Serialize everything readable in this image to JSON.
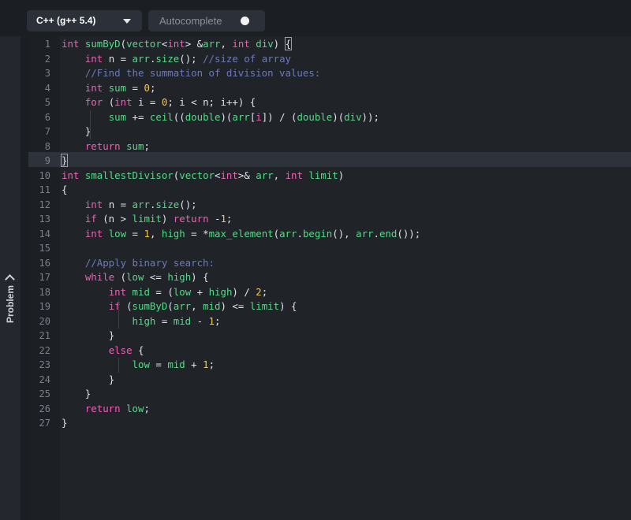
{
  "toolbar": {
    "language": "C++ (g++ 5.4)",
    "autocomplete_label": "Autocomplete"
  },
  "sidebar": {
    "label": "Problem"
  },
  "colors": {
    "keyword": "#f25fb4",
    "type": "#58c1f6",
    "function": "#56db87",
    "number": "#f2c55c",
    "comment": "#6f79b8",
    "text": "#dfe3ea",
    "variable": "#c5d36b"
  },
  "editor": {
    "current_line": 9,
    "lines": [
      {
        "n": "1",
        "t": [
          [
            "k",
            "int"
          ],
          [
            "p",
            " "
          ],
          [
            "f",
            "sumByD"
          ],
          [
            "p",
            "("
          ],
          [
            "f",
            "vector"
          ],
          [
            "p",
            "<"
          ],
          [
            "k",
            "int"
          ],
          [
            "p",
            "> &"
          ],
          [
            "f",
            "arr"
          ],
          [
            "p",
            ", "
          ],
          [
            "k",
            "int"
          ],
          [
            "p",
            " "
          ],
          [
            "f",
            "div"
          ],
          [
            "p",
            ") "
          ],
          [
            "bm",
            "{"
          ]
        ]
      },
      {
        "n": "2",
        "t": [
          [
            "i",
            "    "
          ],
          [
            "k",
            "int"
          ],
          [
            "p",
            " n = "
          ],
          [
            "f",
            "arr"
          ],
          [
            "p",
            "."
          ],
          [
            "f",
            "size"
          ],
          [
            "p",
            "(); "
          ],
          [
            "c",
            "//size of array"
          ]
        ]
      },
      {
        "n": "3",
        "t": [
          [
            "i",
            "    "
          ],
          [
            "c",
            "//Find the summation of division values:"
          ]
        ]
      },
      {
        "n": "4",
        "t": [
          [
            "i",
            "    "
          ],
          [
            "k",
            "int"
          ],
          [
            "p",
            " "
          ],
          [
            "f",
            "sum"
          ],
          [
            "p",
            " = "
          ],
          [
            "num",
            "0"
          ],
          [
            "p",
            ";"
          ]
        ]
      },
      {
        "n": "5",
        "t": [
          [
            "i",
            "    "
          ],
          [
            "k",
            "for"
          ],
          [
            "p",
            " ("
          ],
          [
            "k",
            "int"
          ],
          [
            "p",
            " i = "
          ],
          [
            "num",
            "0"
          ],
          [
            "p",
            "; i < n; i++) {"
          ]
        ]
      },
      {
        "n": "6",
        "t": [
          [
            "i",
            "        "
          ],
          [
            "f",
            "sum"
          ],
          [
            "p",
            " += "
          ],
          [
            "f",
            "ceil"
          ],
          [
            "p",
            "(("
          ],
          [
            "f",
            "double"
          ],
          [
            "p",
            ")("
          ],
          [
            "f",
            "arr"
          ],
          [
            "p",
            "["
          ],
          [
            "k",
            "i"
          ],
          [
            "p",
            "]) / ("
          ],
          [
            "f",
            "double"
          ],
          [
            "p",
            ")("
          ],
          [
            "f",
            "div"
          ],
          [
            "p",
            "));"
          ]
        ]
      },
      {
        "n": "7",
        "t": [
          [
            "i",
            "    "
          ],
          [
            "p",
            "}"
          ]
        ]
      },
      {
        "n": "8",
        "t": [
          [
            "i",
            "    "
          ],
          [
            "k",
            "return"
          ],
          [
            "p",
            " "
          ],
          [
            "f",
            "sum"
          ],
          [
            "p",
            ";"
          ]
        ]
      },
      {
        "n": "9",
        "t": [
          [
            "bm",
            "}"
          ]
        ]
      },
      {
        "n": "10",
        "t": [
          [
            "k",
            "int"
          ],
          [
            "p",
            " "
          ],
          [
            "f",
            "smallestDivisor"
          ],
          [
            "p",
            "("
          ],
          [
            "f",
            "vector"
          ],
          [
            "p",
            "<"
          ],
          [
            "k",
            "int"
          ],
          [
            "p",
            ">& "
          ],
          [
            "f",
            "arr"
          ],
          [
            "p",
            ", "
          ],
          [
            "k",
            "int"
          ],
          [
            "p",
            " "
          ],
          [
            "f",
            "limit"
          ],
          [
            "p",
            ")"
          ]
        ]
      },
      {
        "n": "11",
        "t": [
          [
            "p",
            "{"
          ]
        ]
      },
      {
        "n": "12",
        "t": [
          [
            "i",
            "    "
          ],
          [
            "k",
            "int"
          ],
          [
            "p",
            " n = "
          ],
          [
            "f",
            "arr"
          ],
          [
            "p",
            "."
          ],
          [
            "f",
            "size"
          ],
          [
            "p",
            "();"
          ]
        ]
      },
      {
        "n": "13",
        "t": [
          [
            "i",
            "    "
          ],
          [
            "k",
            "if"
          ],
          [
            "p",
            " (n > "
          ],
          [
            "f",
            "limit"
          ],
          [
            "p",
            ") "
          ],
          [
            "k",
            "return"
          ],
          [
            "p",
            " -"
          ],
          [
            "num",
            "1"
          ],
          [
            "p",
            ";"
          ]
        ]
      },
      {
        "n": "14",
        "t": [
          [
            "i",
            "    "
          ],
          [
            "k",
            "int"
          ],
          [
            "p",
            " "
          ],
          [
            "f",
            "low"
          ],
          [
            "p",
            " = "
          ],
          [
            "num",
            "1"
          ],
          [
            "p",
            ", "
          ],
          [
            "f",
            "high"
          ],
          [
            "p",
            " = *"
          ],
          [
            "f",
            "max_element"
          ],
          [
            "p",
            "("
          ],
          [
            "f",
            "arr"
          ],
          [
            "p",
            "."
          ],
          [
            "f",
            "begin"
          ],
          [
            "p",
            "(), "
          ],
          [
            "f",
            "arr"
          ],
          [
            "p",
            "."
          ],
          [
            "f",
            "end"
          ],
          [
            "p",
            "());"
          ]
        ]
      },
      {
        "n": "15",
        "t": []
      },
      {
        "n": "16",
        "t": [
          [
            "i",
            "    "
          ],
          [
            "c",
            "//Apply binary search:"
          ]
        ]
      },
      {
        "n": "17",
        "t": [
          [
            "i",
            "    "
          ],
          [
            "k",
            "while"
          ],
          [
            "p",
            " ("
          ],
          [
            "f",
            "low"
          ],
          [
            "p",
            " <= "
          ],
          [
            "f",
            "high"
          ],
          [
            "p",
            ") {"
          ]
        ]
      },
      {
        "n": "18",
        "t": [
          [
            "i",
            "        "
          ],
          [
            "k",
            "int"
          ],
          [
            "p",
            " "
          ],
          [
            "f",
            "mid"
          ],
          [
            "p",
            " = ("
          ],
          [
            "f",
            "low"
          ],
          [
            "p",
            " + "
          ],
          [
            "f",
            "high"
          ],
          [
            "p",
            ") / "
          ],
          [
            "num",
            "2"
          ],
          [
            "p",
            ";"
          ]
        ]
      },
      {
        "n": "19",
        "t": [
          [
            "i",
            "        "
          ],
          [
            "k",
            "if"
          ],
          [
            "p",
            " ("
          ],
          [
            "f",
            "sumByD"
          ],
          [
            "p",
            "("
          ],
          [
            "f",
            "arr"
          ],
          [
            "p",
            ", "
          ],
          [
            "f",
            "mid"
          ],
          [
            "p",
            ") <= "
          ],
          [
            "f",
            "limit"
          ],
          [
            "p",
            ") {"
          ]
        ]
      },
      {
        "n": "20",
        "t": [
          [
            "i",
            "            "
          ],
          [
            "f",
            "high"
          ],
          [
            "p",
            " = "
          ],
          [
            "f",
            "mid"
          ],
          [
            "p",
            " - "
          ],
          [
            "num",
            "1"
          ],
          [
            "p",
            ";"
          ]
        ]
      },
      {
        "n": "21",
        "t": [
          [
            "i",
            "        "
          ],
          [
            "p",
            "}"
          ]
        ]
      },
      {
        "n": "22",
        "t": [
          [
            "i",
            "        "
          ],
          [
            "k",
            "else"
          ],
          [
            "p",
            " {"
          ]
        ]
      },
      {
        "n": "23",
        "t": [
          [
            "i",
            "            "
          ],
          [
            "f",
            "low"
          ],
          [
            "p",
            " = "
          ],
          [
            "f",
            "mid"
          ],
          [
            "p",
            " + "
          ],
          [
            "num",
            "1"
          ],
          [
            "p",
            ";"
          ]
        ]
      },
      {
        "n": "24",
        "t": [
          [
            "i",
            "        "
          ],
          [
            "p",
            "}"
          ]
        ]
      },
      {
        "n": "25",
        "t": [
          [
            "i",
            "    "
          ],
          [
            "p",
            "}"
          ]
        ]
      },
      {
        "n": "26",
        "t": [
          [
            "i",
            "    "
          ],
          [
            "k",
            "return"
          ],
          [
            "p",
            " "
          ],
          [
            "f",
            "low"
          ],
          [
            "p",
            ";"
          ]
        ]
      },
      {
        "n": "27",
        "t": [
          [
            "p",
            "}"
          ]
        ]
      }
    ]
  }
}
